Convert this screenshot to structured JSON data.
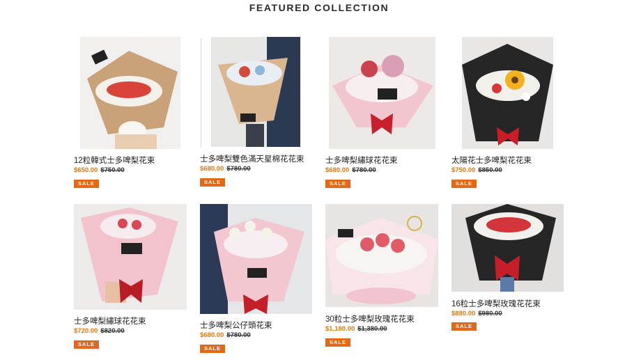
{
  "section": {
    "title": "FEATURED COLLECTION"
  },
  "products": [
    {
      "name": "12粒韓式士多啤梨花束",
      "price": "$650.00",
      "old_price": "$750.00",
      "badge": "SALE"
    },
    {
      "name": "士多啤梨雙色滿天星棉花花束",
      "price": "$680.00",
      "old_price": "$780.00",
      "badge": "SALE"
    },
    {
      "name": "士多啤梨繡球花花束",
      "price": "$680.00",
      "old_price": "$780.00",
      "badge": "SALE"
    },
    {
      "name": "太陽花士多啤梨花花束",
      "price": "$750.00",
      "old_price": "$850.00",
      "badge": "SALE"
    },
    {
      "name": "士多啤梨繡球花花束",
      "price": "$720.00",
      "old_price": "$820.00",
      "badge": "SALE"
    },
    {
      "name": "士多啤梨公仔頭花束",
      "price": "$680.00",
      "old_price": "$780.00",
      "badge": "SALE"
    },
    {
      "name": "30粒士多啤梨玫瑰花花束",
      "price": "$1,180.00",
      "old_price": "$1,380.00",
      "badge": "SALE"
    },
    {
      "name": "16粒士多啤梨玫瑰花花束",
      "price": "$880.00",
      "old_price": "$980.00",
      "badge": "SALE"
    }
  ],
  "colors": {
    "sale_badge": "#e0691a",
    "price": "#e07a10"
  }
}
